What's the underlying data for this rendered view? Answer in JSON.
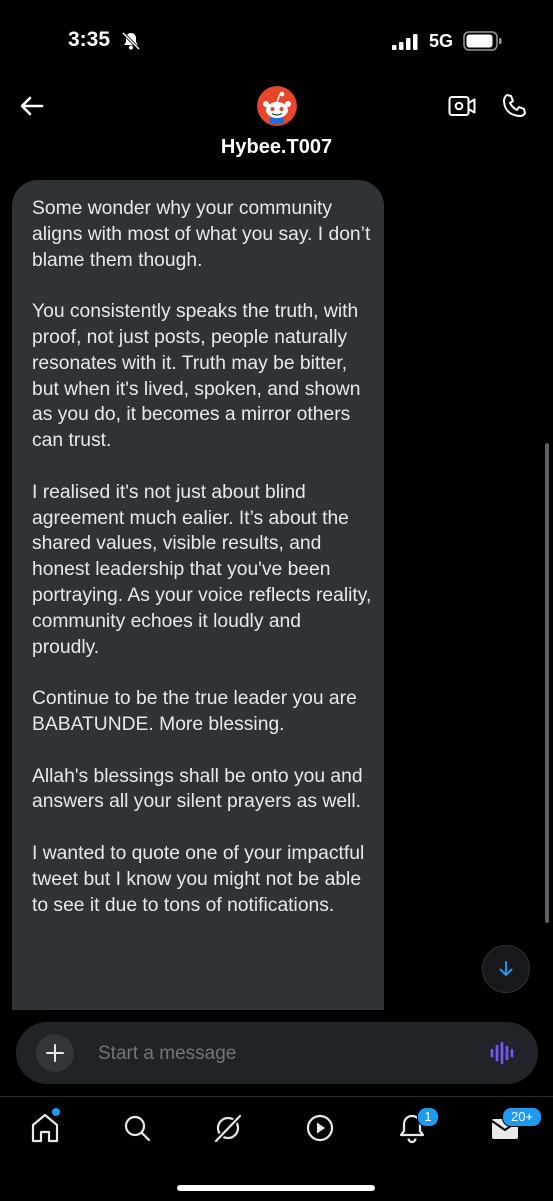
{
  "status_bar": {
    "time": "3:35",
    "network": "5G"
  },
  "header": {
    "username": "Hybee.T007"
  },
  "conversation": {
    "message": "Some wonder why your community aligns with most of what you say. I don’t blame them though.\n\nYou consistently speaks the truth, with proof, not just posts, people naturally resonates with it. Truth may be bitter, but when it's lived, spoken, and shown as you do, it becomes a mirror others can trust.\n\nI realised it's not just about blind agreement much ealier. It’s about the shared values, visible results, and honest leadership that you've been portraying. As your voice reflects reality, community echoes it loudly and proudly.\n\nContinue to be the true leader you are BABATUNDE. More blessing.\n\nAllah's blessings shall be onto you and answers all your silent prayers as well.\n\nI wanted to quote one of your impactful tweet but I know you might not be able to see it due to tons of notifications."
  },
  "composer": {
    "placeholder": "Start a message"
  },
  "tabbar": {
    "notifications_badge": "1",
    "messages_badge": "20+"
  },
  "colors": {
    "accent": "#1d9bf0",
    "voice": "#7856ff",
    "bubble": "#2f3336"
  }
}
